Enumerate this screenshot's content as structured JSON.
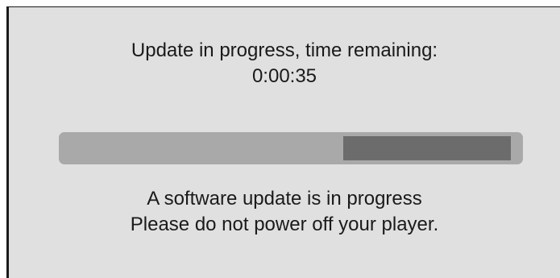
{
  "dialog": {
    "heading_line1": "Update in progress, time remaining:",
    "time_remaining": "0:00:35",
    "progress": {
      "fraction_complete": 0.63,
      "track_color": "#a9a9a9",
      "remaining_color": "#6c6c6c"
    },
    "message_line1": "A software update is in progress",
    "message_line2": "Please do not power off your player."
  }
}
